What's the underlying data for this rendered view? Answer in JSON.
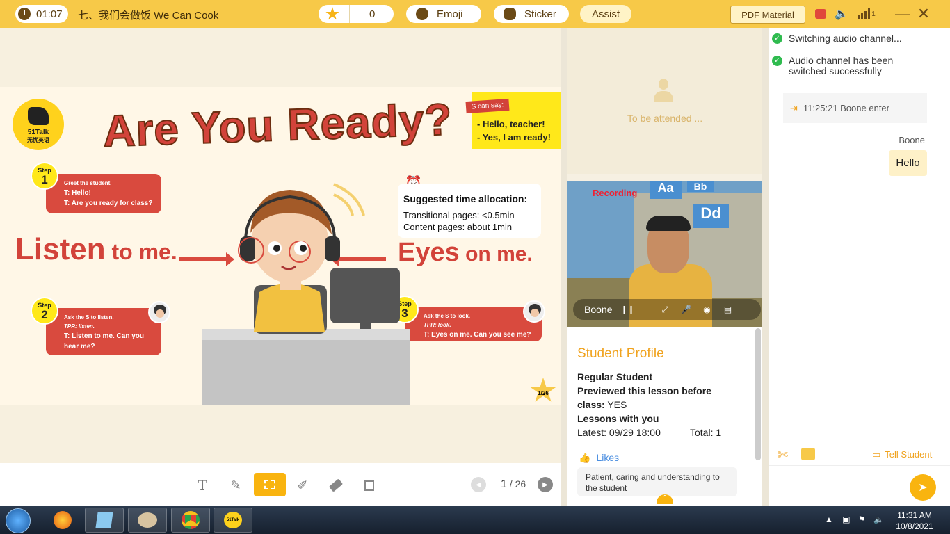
{
  "topbar": {
    "timer": "01:07",
    "lesson_title": "七、我们会做饭 We Can Cook",
    "star_count": "0",
    "emoji_label": "Emoji",
    "sticker_label": "Sticker",
    "assist_label": "Assist",
    "pdf_label": "PDF Material",
    "signal_count": "1"
  },
  "slide": {
    "logo_text": "51Talk",
    "logo_sub": "无忧英语",
    "title": "Are You Ready?",
    "s_can_say": "S can say:",
    "say_lines": [
      "- Hello, teacher!",
      "- Yes, I am ready!"
    ],
    "step_label": "Step",
    "step1": {
      "num": "1",
      "small": "Greet the student.",
      "lines": [
        "T: Hello!",
        "T: Are you ready for class?"
      ]
    },
    "step2": {
      "num": "2",
      "small": "Ask the S to listen.",
      "tpr": "TPR: listen.",
      "lines": [
        "T: Listen to me. Can you",
        "hear me?"
      ]
    },
    "step3": {
      "num": "3",
      "small": "Ask the S to look.",
      "tpr": "TPR: look.",
      "lines": [
        "T: Eyes on me. Can you see me?"
      ]
    },
    "listen_big": "Listen",
    "listen_rest": " to me.",
    "eyes_big": "Eyes",
    "eyes_rest": " on me.",
    "time_title": "Suggested time allocation:",
    "time_lines": [
      "Transitional pages: <0.5min",
      "Content pages: about 1min"
    ],
    "page_badge": "1/26"
  },
  "pager": {
    "current": "1",
    "sep": " / ",
    "total": "26"
  },
  "waiting": {
    "text": "To be attended ..."
  },
  "video": {
    "recording": "Recording",
    "name": "Boone"
  },
  "profile": {
    "title": "Student Profile",
    "type": "Regular Student",
    "previewed_label": "Previewed this lesson before",
    "class_label": "class:",
    "class_value": " YES",
    "lessons_label": "Lessons with you",
    "latest": "Latest: 09/29 18:00",
    "total": "Total: 1",
    "likes_label": "Likes",
    "like_text": "Patient, caring and understanding to the student"
  },
  "chat": {
    "sys1": "Switching audio channel...",
    "sys2": "Audio channel has been switched successfully",
    "enter": "11:25:21 Boone enter",
    "sender": "Boone",
    "message": "Hello",
    "tell_student": "Tell Student"
  },
  "taskbar": {
    "time": "11:31 AM",
    "date": "10/8/2021",
    "app_label": "51Talk"
  },
  "colors": {
    "accent": "#f9b40f",
    "topbar": "#f7c948",
    "slide_red": "#d2433a"
  }
}
